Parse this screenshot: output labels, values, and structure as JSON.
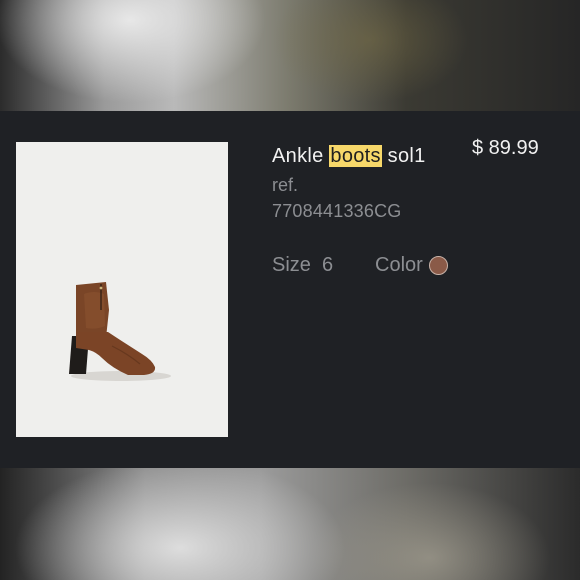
{
  "product": {
    "title_before": "Ankle ",
    "title_highlight": "boots",
    "title_after": " sol1",
    "price": "$ 89.99",
    "ref_label": "ref.",
    "ref_code": "7708441336CG",
    "size_label": "Size",
    "size_value": "6",
    "color_label": "Color",
    "color_hex": "#8a5a48"
  }
}
